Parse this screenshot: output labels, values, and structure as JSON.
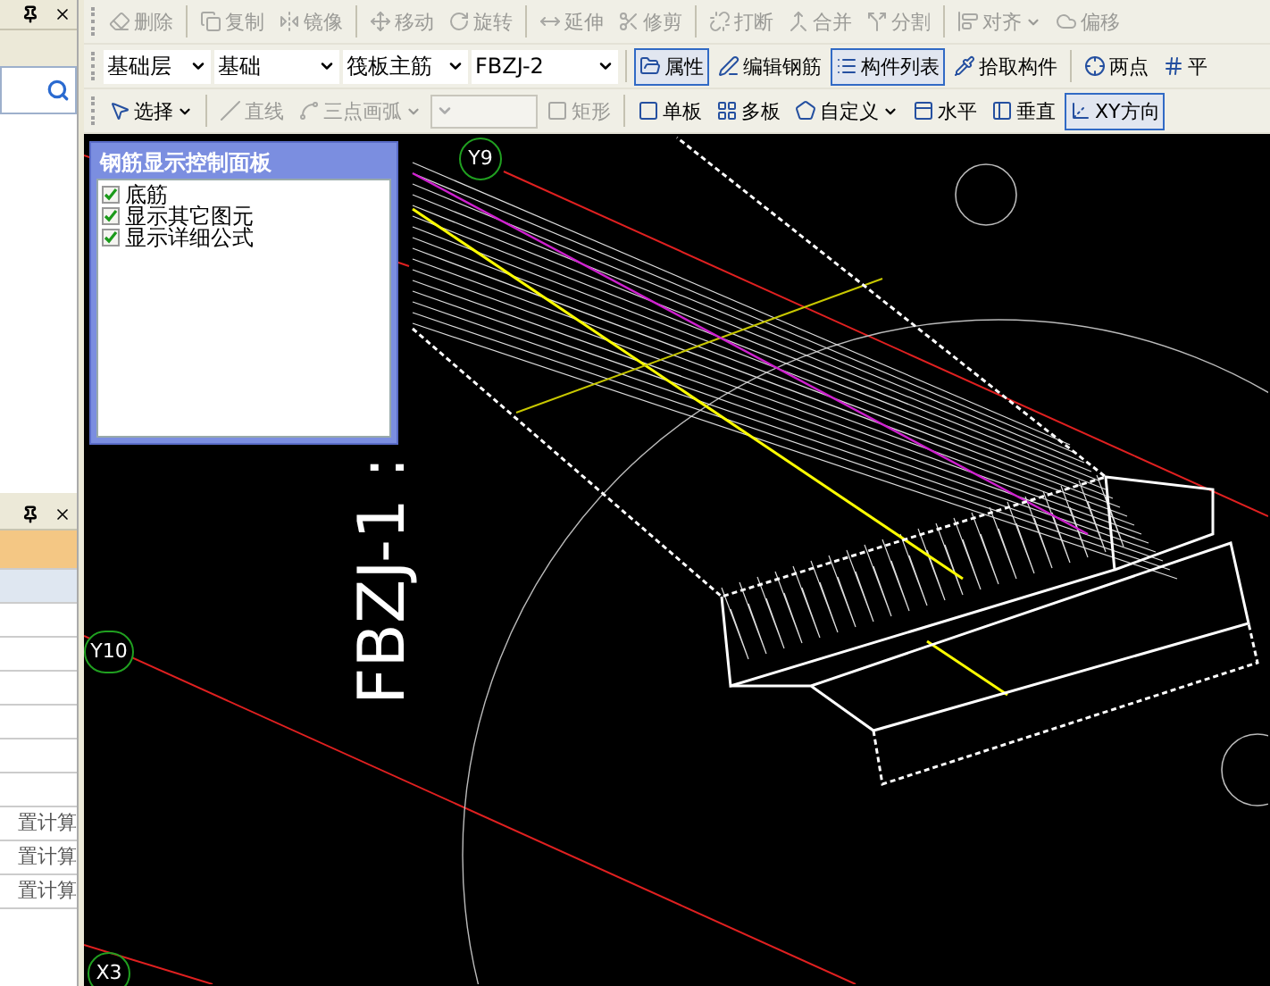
{
  "toolbars": [
    {
      "items": [
        {
          "kind": "button",
          "label": "删除",
          "disabled": true,
          "selected": false,
          "menu": false
        },
        {
          "kind": "separator"
        },
        {
          "kind": "button",
          "label": "复制",
          "disabled": true,
          "selected": false,
          "menu": false
        },
        {
          "kind": "button",
          "label": "镜像",
          "disabled": true,
          "selected": false,
          "menu": false
        },
        {
          "kind": "separator"
        },
        {
          "kind": "button",
          "label": "移动",
          "disabled": true,
          "selected": false,
          "menu": false
        },
        {
          "kind": "button",
          "label": "旋转",
          "disabled": true,
          "selected": false,
          "menu": false
        },
        {
          "kind": "separator"
        },
        {
          "kind": "button",
          "label": "延伸",
          "disabled": true,
          "selected": false,
          "menu": false
        },
        {
          "kind": "button",
          "label": "修剪",
          "disabled": true,
          "selected": false,
          "menu": false
        },
        {
          "kind": "separator"
        },
        {
          "kind": "button",
          "label": "打断",
          "disabled": true,
          "selected": false,
          "menu": false
        },
        {
          "kind": "button",
          "label": "合并",
          "disabled": true,
          "selected": false,
          "menu": false
        },
        {
          "kind": "button",
          "label": "分割",
          "disabled": true,
          "selected": false,
          "menu": false
        },
        {
          "kind": "separator"
        },
        {
          "kind": "button",
          "label": "对齐",
          "disabled": true,
          "selected": false,
          "menu": true
        },
        {
          "kind": "button",
          "label": "偏移",
          "disabled": true,
          "selected": false,
          "menu": false
        }
      ]
    },
    {
      "items": [
        {
          "kind": "combo",
          "label": "基础层",
          "disabled": false
        },
        {
          "kind": "combo",
          "label": "基础",
          "disabled": false
        },
        {
          "kind": "combo",
          "label": "筏板主筋",
          "disabled": false
        },
        {
          "kind": "combo",
          "label": "FBZJ-2",
          "disabled": false
        },
        {
          "kind": "separator"
        },
        {
          "kind": "button",
          "label": "属性",
          "disabled": false,
          "selected": true,
          "menu": false
        },
        {
          "kind": "button",
          "label": "编辑钢筋",
          "disabled": false,
          "selected": false,
          "menu": false
        },
        {
          "kind": "button",
          "label": "构件列表",
          "disabled": false,
          "selected": true,
          "menu": false
        },
        {
          "kind": "button",
          "label": "拾取构件",
          "disabled": false,
          "selected": false,
          "menu": false
        },
        {
          "kind": "separator"
        },
        {
          "kind": "button",
          "label": "两点",
          "disabled": false,
          "selected": false,
          "menu": false
        },
        {
          "kind": "button",
          "label": "平",
          "disabled": false,
          "selected": false,
          "menu": false
        }
      ]
    },
    {
      "items": [
        {
          "kind": "button",
          "label": "选择",
          "disabled": false,
          "selected": false,
          "menu": true
        },
        {
          "kind": "separator"
        },
        {
          "kind": "button",
          "label": "直线",
          "disabled": true,
          "selected": false,
          "menu": false
        },
        {
          "kind": "button",
          "label": "三点画弧",
          "disabled": true,
          "selected": false,
          "menu": true
        },
        {
          "kind": "combo",
          "disabled": true
        },
        {
          "kind": "button",
          "label": "矩形",
          "disabled": true,
          "selected": false,
          "menu": false
        },
        {
          "kind": "separator"
        },
        {
          "kind": "button",
          "label": "单板",
          "disabled": false,
          "selected": false,
          "menu": false
        },
        {
          "kind": "button",
          "label": "多板",
          "disabled": false,
          "selected": false,
          "menu": false
        },
        {
          "kind": "button",
          "label": "自定义",
          "disabled": false,
          "selected": false,
          "menu": true
        },
        {
          "kind": "button",
          "label": "水平",
          "disabled": false,
          "selected": false,
          "menu": false
        },
        {
          "kind": "button",
          "label": "垂直",
          "disabled": false,
          "selected": false,
          "menu": false
        },
        {
          "kind": "button",
          "label": "XY方向",
          "disabled": false,
          "selected": true,
          "menu": false
        }
      ]
    }
  ],
  "left_table": {
    "rows": [
      {
        "text": "置计算"
      },
      {
        "text": "置计算"
      },
      {
        "text": "置计算"
      }
    ]
  },
  "floating_panel": {
    "title": "钢筋显示控制面板",
    "options": [
      {
        "label": "底筋",
        "checked": true
      },
      {
        "label": "显示其它图元",
        "checked": true
      },
      {
        "label": "显示详细公式",
        "checked": true
      }
    ]
  },
  "canvas": {
    "axis_labels": [
      {
        "text": "Y9"
      },
      {
        "text": "Y10"
      },
      {
        "text": "X3"
      }
    ],
    "member_label": "FBZJ-1 :"
  }
}
